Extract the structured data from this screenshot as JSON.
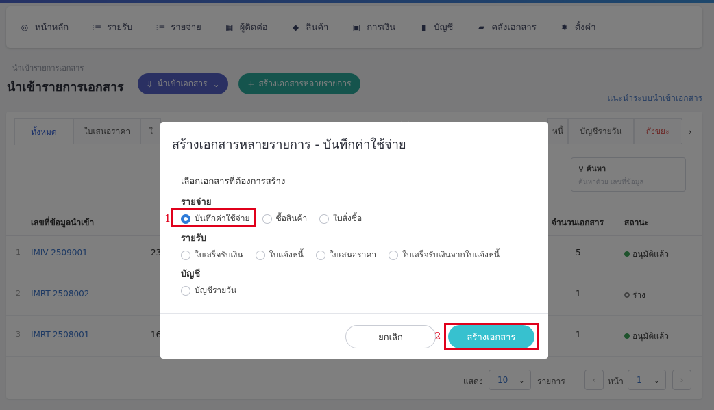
{
  "nav": {
    "items": [
      {
        "label": "หน้าหลัก",
        "icon": "dashboard-icon"
      },
      {
        "label": "รายรับ",
        "icon": "list-icon"
      },
      {
        "label": "รายจ่าย",
        "icon": "list-icon"
      },
      {
        "label": "ผู้ติดต่อ",
        "icon": "contacts-icon"
      },
      {
        "label": "สินค้า",
        "icon": "box-icon"
      },
      {
        "label": "การเงิน",
        "icon": "money-icon"
      },
      {
        "label": "บัญชี",
        "icon": "book-icon"
      },
      {
        "label": "คลังเอกสาร",
        "icon": "folder-icon"
      },
      {
        "label": "ตั้งค่า",
        "icon": "gear-icon"
      }
    ]
  },
  "page": {
    "breadcrumb": "นำเข้ารายการเอกสาร",
    "title": "นำเข้ารายการเอกสาร",
    "import_button": "นำเข้าเอกสาร",
    "multi_button": "สร้างเอกสารหลายรายการ",
    "guide_link": "แนะนำระบบนำเข้าเอกสาร"
  },
  "tabs": {
    "all": "ทั้งหมด",
    "quotation": "ใบเสนอราคา",
    "daily": "บัญชีรายวัน",
    "trash": "ถังขยะ",
    "partial_a": "ใ",
    "partial_b": "หนี้"
  },
  "search": {
    "label": "ค้นหา",
    "placeholder": "ค้นหาด้วย เลขที่ข้อมูล"
  },
  "table": {
    "headers": {
      "docno": "เลขที่ข้อมูลนำเข้า",
      "count": "จำนวนเอกสาร",
      "status": "สถานะ"
    },
    "rows": [
      {
        "idx": "1",
        "docno": "IMIV-2509001",
        "amt": "23",
        "count": "5",
        "status": "อนุมัติแล้ว",
        "dot": "filled"
      },
      {
        "idx": "2",
        "docno": "IMRT-2508002",
        "amt": "",
        "count": "1",
        "status": "ร่าง",
        "dot": "empty"
      },
      {
        "idx": "3",
        "docno": "IMRT-2508001",
        "amt": "16",
        "count": "1",
        "status": "อนุมัติแล้ว",
        "dot": "filled"
      }
    ]
  },
  "pager": {
    "show": "แสดง",
    "per_page": "10",
    "items": "รายการ",
    "page_label": "หน้า",
    "page": "1"
  },
  "modal": {
    "title": "สร้างเอกสารหลายรายการ - บันทึกค่าใช้จ่าย",
    "subtitle": "เลือกเอกสารที่ต้องการสร้าง",
    "groups": {
      "expense": {
        "label": "รายจ่าย",
        "options": [
          "บันทึกค่าใช้จ่าย",
          "ซื้อสินค้า",
          "ใบสั่งซื้อ"
        ]
      },
      "income": {
        "label": "รายรับ",
        "options": [
          "ใบเสร็จรับเงิน",
          "ใบแจ้งหนี้",
          "ใบเสนอราคา",
          "ใบเสร็จรับเงินจากใบแจ้งหนี้"
        ]
      },
      "account": {
        "label": "บัญชี",
        "options": [
          "บัญชีรายวัน"
        ]
      }
    },
    "selected": "บันทึกค่าใช้จ่าย",
    "cancel": "ยกเลิก",
    "create": "สร้างเอกสาร"
  },
  "annotations": {
    "step1": "1",
    "step2": "2"
  },
  "colors": {
    "primary": "#5460c4",
    "teal": "#2aa89a",
    "create": "#37c1cf",
    "highlight": "#e0001b"
  }
}
